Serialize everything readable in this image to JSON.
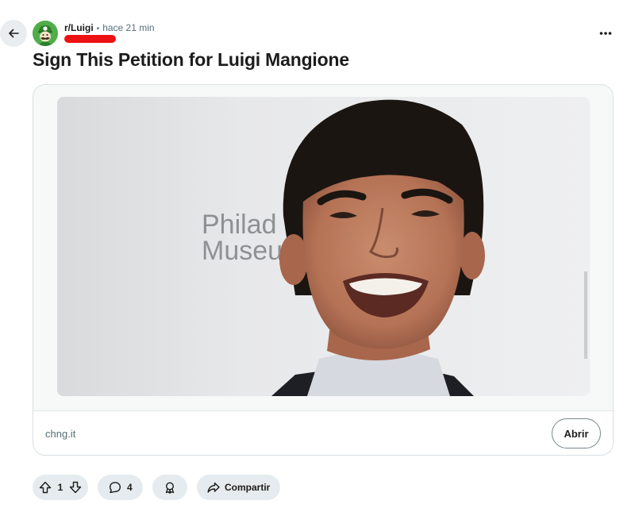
{
  "post": {
    "subreddit": "r/Luigi",
    "separator": "•",
    "timestamp": "hace 21 min",
    "title": "Sign This Petition for Luigi Mangione"
  },
  "link_card": {
    "image_sign_line1": "Philad",
    "image_sign_line2": "Museu",
    "domain": "chng.it",
    "open_label": "Abrir"
  },
  "actions": {
    "vote_count": "1",
    "comment_count": "4",
    "share_label": "Compartir"
  },
  "icons": {
    "back": "arrow-left-icon",
    "more": "more-horizontal-icon",
    "upvote": "upvote-arrow-icon",
    "downvote": "downvote-arrow-icon",
    "comment": "comment-bubble-icon",
    "award": "award-icon",
    "share": "share-arrow-icon"
  },
  "colors": {
    "avatar_bg": "#4fae4a",
    "redaction": "#ee1111",
    "pill_bg": "#e5ebee",
    "text_primary": "#1c1c1c",
    "text_secondary": "#576f76"
  }
}
